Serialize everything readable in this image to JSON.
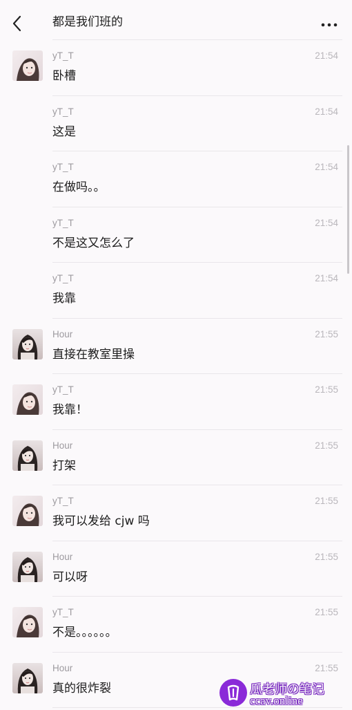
{
  "header": {
    "title": "都是我们班的",
    "back_icon": "chevron-left-icon",
    "more_icon": "ellipsis-icon"
  },
  "messages": [
    {
      "sender": "yT_T",
      "time": "21:54",
      "text": "卧槽",
      "avatar": "yT_T"
    },
    {
      "sender": "yT_T",
      "time": "21:54",
      "text": "这是",
      "avatar": ""
    },
    {
      "sender": "yT_T",
      "time": "21:54",
      "text": "在做吗。。",
      "avatar": ""
    },
    {
      "sender": "yT_T",
      "time": "21:54",
      "text": "不是这又怎么了",
      "avatar": ""
    },
    {
      "sender": "yT_T",
      "time": "21:54",
      "text": "我靠",
      "avatar": ""
    },
    {
      "sender": "Hour",
      "time": "21:55",
      "text": "直接在教室里操",
      "avatar": "Hour"
    },
    {
      "sender": "yT_T",
      "time": "21:55",
      "text": "我靠！",
      "avatar": "yT_T"
    },
    {
      "sender": "Hour",
      "time": "21:55",
      "text": "打架",
      "avatar": "Hour"
    },
    {
      "sender": "yT_T",
      "time": "21:55",
      "text": "我可以发给 cjw 吗",
      "avatar": "yT_T"
    },
    {
      "sender": "Hour",
      "time": "21:55",
      "text": "可以呀",
      "avatar": "Hour"
    },
    {
      "sender": "yT_T",
      "time": "21:55",
      "text": "不是。。。。。。",
      "avatar": "yT_T"
    },
    {
      "sender": "Hour",
      "time": "21:55",
      "text": "真的很炸裂",
      "avatar": "Hour"
    }
  ],
  "watermark": {
    "logo_char": "瓜",
    "name": "瓜老师の笔记",
    "url": "ccav.online"
  }
}
